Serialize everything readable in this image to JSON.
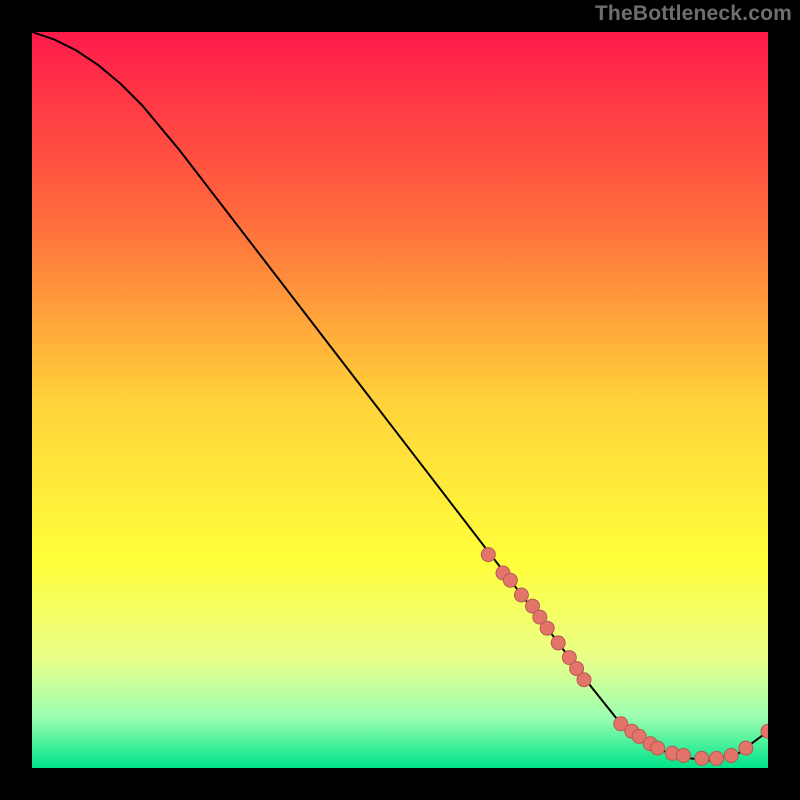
{
  "watermark": "TheBottleneck.com",
  "chart_data": {
    "type": "line",
    "title": "",
    "xlabel": "",
    "ylabel": "",
    "xlim": [
      0,
      100
    ],
    "ylim": [
      0,
      100
    ],
    "grid": false,
    "legend": false,
    "background_gradient": {
      "stops": [
        {
          "pos": 0.0,
          "color": "#ff1a4b"
        },
        {
          "pos": 0.25,
          "color": "#ff6a3c"
        },
        {
          "pos": 0.5,
          "color": "#ffd23a"
        },
        {
          "pos": 0.72,
          "color": "#ffff3a"
        },
        {
          "pos": 0.85,
          "color": "#eaff8a"
        },
        {
          "pos": 0.93,
          "color": "#9cffb0"
        },
        {
          "pos": 1.0,
          "color": "#00e38a"
        }
      ]
    },
    "series": [
      {
        "name": "curve",
        "type": "line",
        "stroke": "#000000",
        "x": [
          0,
          3,
          6,
          9,
          12,
          15,
          20,
          30,
          40,
          50,
          60,
          70,
          76,
          80,
          84,
          88,
          92,
          96,
          100
        ],
        "y": [
          100,
          99,
          97.5,
          95.5,
          93,
          90,
          84,
          71,
          58,
          45,
          32,
          19,
          11,
          6,
          3,
          1.5,
          1,
          2,
          5
        ]
      },
      {
        "name": "markers",
        "type": "scatter",
        "fill": "#e2746a",
        "stroke": "#b85a52",
        "x": [
          62,
          64,
          65,
          66.5,
          68,
          69,
          70,
          71.5,
          73,
          74,
          75,
          80,
          81.5,
          82.5,
          84,
          85,
          87,
          88.5,
          91,
          93,
          95,
          97,
          100
        ],
        "y": [
          29,
          26.5,
          25.5,
          23.5,
          22,
          20.5,
          19,
          17,
          15,
          13.5,
          12,
          6,
          5,
          4.3,
          3.3,
          2.7,
          2,
          1.7,
          1.3,
          1.3,
          1.7,
          2.7,
          5
        ]
      }
    ]
  }
}
